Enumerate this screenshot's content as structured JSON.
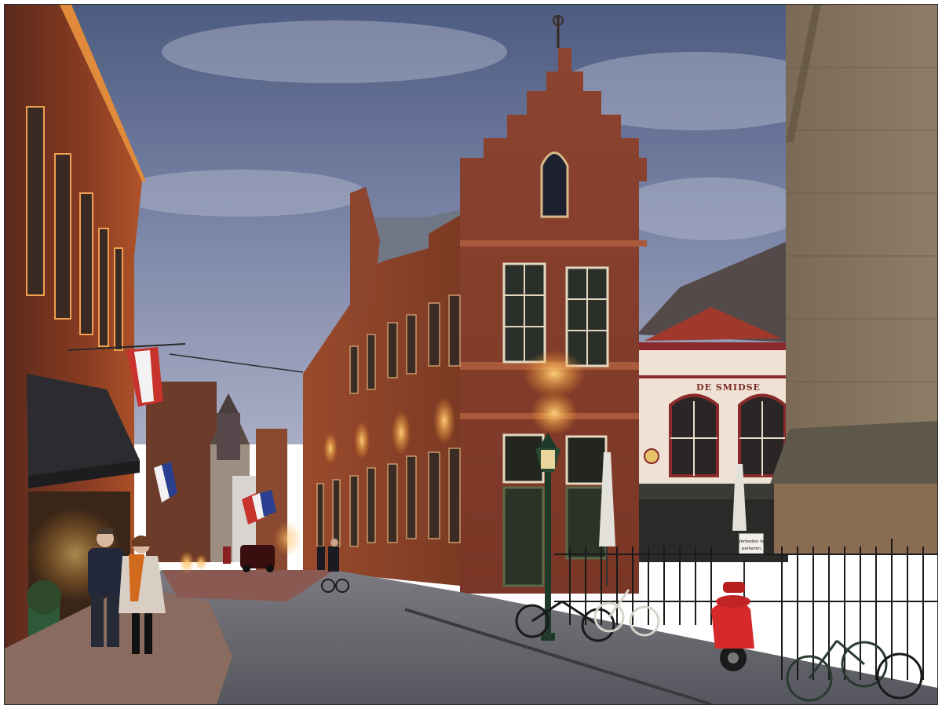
{
  "scene": {
    "shop_sign": "DE SMIDSE",
    "placard_line1": "Verboden te",
    "placard_line2": "parkeren"
  },
  "palette": {
    "sky_top": "#4f5e82",
    "sky_bottom": "#a3a9c1",
    "brick": "#8c3f28",
    "brick_dark": "#5a2618",
    "lamp_glow": "#ffb347",
    "cobble": "#6e6f78",
    "scooter_red": "#d62a2a",
    "flag_red": "#c8332e",
    "flag_blue": "#2a3f8f"
  }
}
